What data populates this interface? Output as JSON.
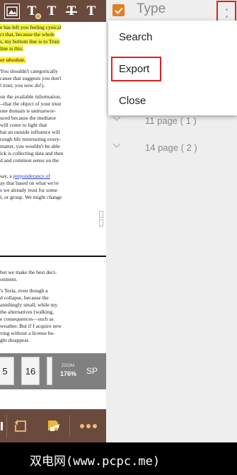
{
  "reader": {
    "toolbar_tools": [
      "T",
      "T",
      "T",
      "T",
      "T"
    ],
    "page1_lines": [
      {
        "t": "e has left you feeling cynical",
        "hl": true
      },
      {
        "t": "ct that, because the whole",
        "hl": true
      },
      {
        "t": "s, my bottom line is to Trust",
        "hl": true
      },
      {
        "t": "line is this:",
        "hl": true
      },
      {
        "t": "",
        "gap": true
      },
      {
        "t": "or absolute.",
        "hlb": true
      },
      {
        "t": "",
        "gap": true
      },
      {
        "t": "You shouldn't categorically"
      },
      {
        "t": "cause that suggests you don't"
      },
      {
        "t": "l trust, you now do!)."
      },
      {
        "t": "",
        "gap": true
      },
      {
        "t": "on the available information."
      },
      {
        "t": "--that the object of your trust"
      },
      {
        "t": "one domain is untrustwor-"
      },
      {
        "t": "uced because the mediator"
      },
      {
        "t": "will come to light that"
      },
      {
        "t": "hat an outside influence will"
      },
      {
        "t": "rough life mistrusting every-"
      },
      {
        "t": "matter, you wouldn't be able"
      },
      {
        "t": "ick is collecting data and then"
      },
      {
        "t": "d and common sense on the"
      },
      {
        "t": "",
        "gap": true
      },
      {
        "t": "",
        "gap": true
      },
      {
        "t": "say, a ",
        "link": "preponderance of"
      },
      {
        "t": "ay that based on what we're"
      },
      {
        "t": "s we already trust for some"
      },
      {
        "t": "l, or group. We might change"
      }
    ],
    "page2_lines": [
      {
        "t": "but we make the best deci-"
      },
      {
        "t": "onment."
      },
      {
        "t": "",
        "gap": true
      },
      {
        "t": "'s Tesla, even though a"
      },
      {
        "t": "d collapse, because the"
      },
      {
        "t": "anishingly small, while my"
      },
      {
        "t": "the alternatives (walking,"
      },
      {
        "t": "e consequences—such as"
      },
      {
        "t": "weather. But if I acquire new"
      },
      {
        "t": "ving without a license be-"
      },
      {
        "t": "ght disappear."
      }
    ],
    "thumbnails": [
      "5",
      "16"
    ],
    "zoom_label": "ZOOM",
    "zoom_value": "176%",
    "sp_label": "SP"
  },
  "right_pane": {
    "header_label": "Type",
    "tree_rows": [
      {
        "label": "11 page ( 1 )"
      },
      {
        "label": "14 page ( 2 )"
      }
    ]
  },
  "menu": {
    "items": [
      "Search",
      "Export",
      "Close"
    ]
  },
  "watermark": "双电网(www.pcpc.me)",
  "colors": {
    "toolbar_brown": "#6b4a3e",
    "accent_orange": "#e67e22",
    "highlight_yellow": "#f6f53a",
    "callout_red": "#e02020"
  }
}
